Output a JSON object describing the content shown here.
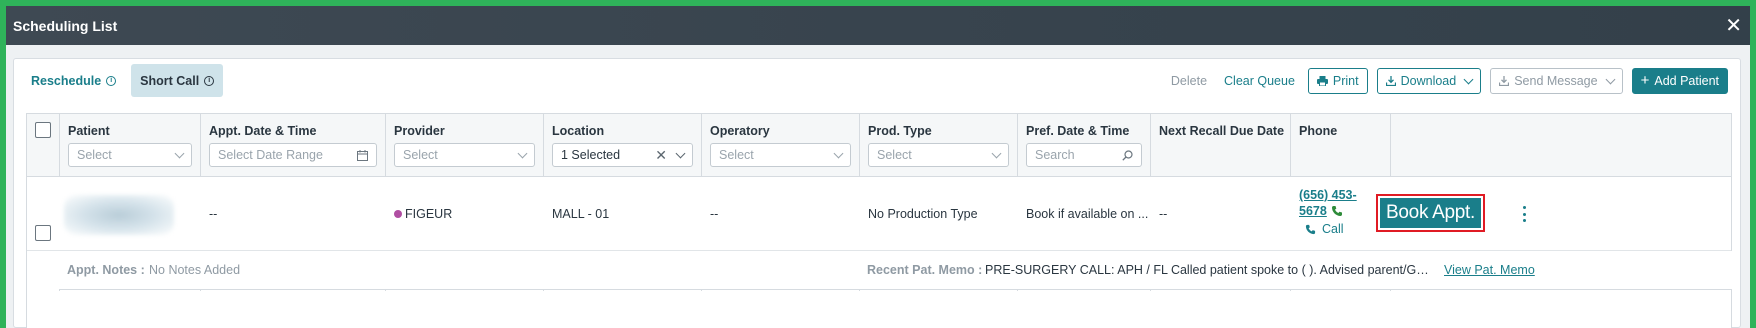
{
  "window": {
    "title": "Scheduling List"
  },
  "tabs": [
    {
      "label": "Reschedule",
      "active": false
    },
    {
      "label": "Short Call",
      "active": true
    }
  ],
  "actions": {
    "delete": "Delete",
    "clear_queue": "Clear Queue",
    "print": "Print",
    "download": "Download",
    "send_message": "Send Message",
    "add_patient": "Add Patient"
  },
  "columns": [
    {
      "label": "Patient",
      "filter": "Select"
    },
    {
      "label": "Appt. Date & Time",
      "filter": "Select Date Range"
    },
    {
      "label": "Provider",
      "filter": "Select"
    },
    {
      "label": "Location",
      "filter": "1 Selected"
    },
    {
      "label": "Operatory",
      "filter": "Select"
    },
    {
      "label": "Prod. Type",
      "filter": "Select"
    },
    {
      "label": "Pref. Date & Time",
      "filter": "Search"
    },
    {
      "label": "Next Recall Due Date"
    },
    {
      "label": "Phone"
    }
  ],
  "row": {
    "appt_date": "--",
    "provider": "FIGEUR",
    "provider_color": "#b04ea2",
    "location": "MALL - 01",
    "operatory": "--",
    "prod_type": "No Production Type",
    "pref_date": "Book if available on ...",
    "next_recall": "--",
    "phone_line1": "(656) 453-",
    "phone_line2": "5678",
    "call_label": "Call",
    "book_label": "Book Appt."
  },
  "notes": {
    "appt_notes_label": "Appt. Notes :",
    "appt_notes_value": "No Notes Added",
    "memo_label": "Recent Pat. Memo :",
    "memo_value": "PRE-SURGERY CALL: APH / FL Called patient spoke to ( ). Advised parent/Guardian...",
    "memo_link": "View Pat. Memo"
  },
  "colors": {
    "accent": "#1a7e8a",
    "title_bar": "#3b4650",
    "highlight_border": "#e01b24",
    "frame": "#2fb35a"
  }
}
